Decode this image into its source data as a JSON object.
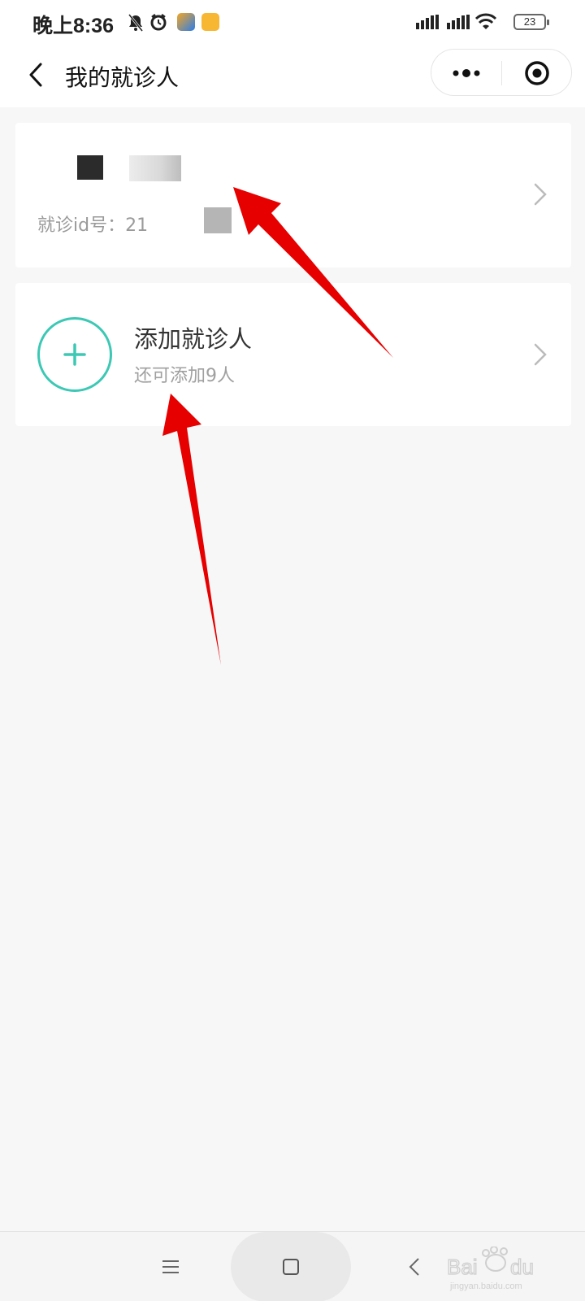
{
  "status_bar": {
    "time": "晚上8:36",
    "battery": "23",
    "icons": [
      "bell-off-icon",
      "alarm-icon",
      "app-icon",
      "message-app-icon",
      "signal-icon",
      "signal-icon",
      "wifi-icon",
      "battery-icon"
    ]
  },
  "header": {
    "title": "我的就诊人",
    "back_icon": "back-icon",
    "more_icon": "more-dots-icon",
    "close_icon": "target-close-icon"
  },
  "patient_card": {
    "id_text": "就诊id号：21"
  },
  "add_card": {
    "title": "添加就诊人",
    "subtitle": "还可添加9人",
    "icon": "plus-circle-icon"
  },
  "annotations": {
    "arrow_color": "#e60000"
  },
  "system_nav": {
    "icons": [
      "menu-icon",
      "home-icon",
      "back-icon"
    ]
  },
  "colors": {
    "accent": "#3cc8b4",
    "background": "#f7f7f7"
  }
}
